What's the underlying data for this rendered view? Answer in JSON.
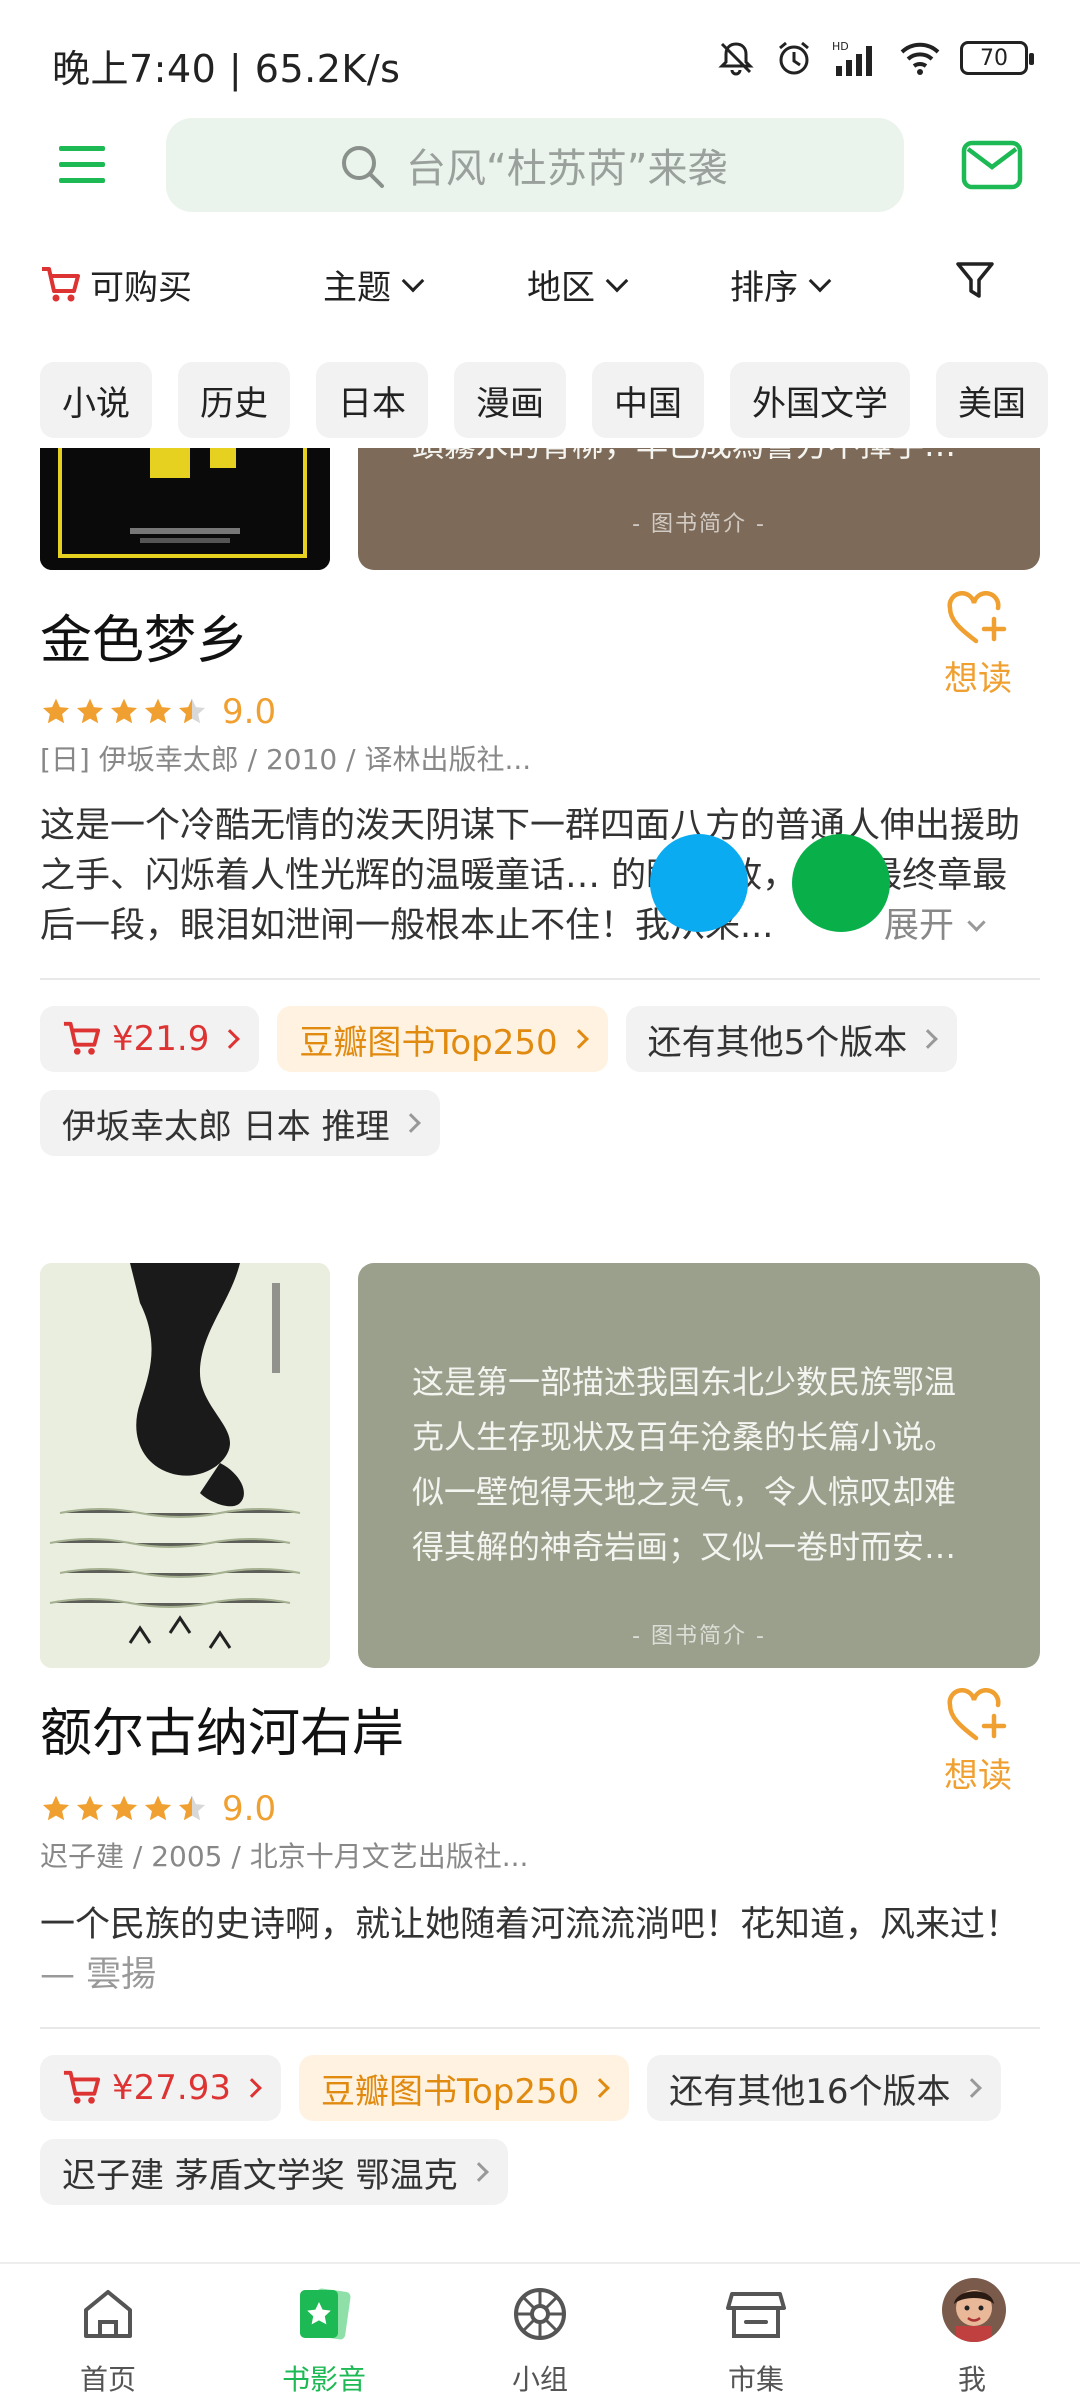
{
  "status_bar": {
    "time_speed": "晚上7:40 | 65.2K/s",
    "battery": "70",
    "icons": [
      "mute-icon",
      "alarm-icon",
      "signal-icon",
      "wifi-icon",
      "battery-icon"
    ]
  },
  "topbar": {
    "search_placeholder": "台风“杜苏芮”来袭",
    "icons": [
      "menu-icon",
      "search-icon",
      "mail-icon"
    ]
  },
  "filters": {
    "buyable": "可购买",
    "theme": "主题",
    "region": "地区",
    "sort": "排序"
  },
  "tags": [
    "小说",
    "历史",
    "日本",
    "漫画",
    "中国",
    "外国文学",
    "美国"
  ],
  "books": [
    {
      "intro_text": "頭霧水的青柳，早已成為警方不擇手…",
      "intro_label": "- 图书简介 -",
      "title": "金色梦乡",
      "rating": "9.0",
      "stars": 4.5,
      "want_label": "想读",
      "meta": "[日] 伊坂幸太郎 / 2010 / 译林出版社...",
      "review": "这是一个冷酷无情的泼天阴谋下一群四面八方的普通人伸出援助之手、闪烁着人性光辉的温暖童话…      的眼泪  收，读到最终章最后一段，眼泪如泄闸一般根本止不住！我从来...",
      "expand_label": "展开",
      "price": "¥21.9",
      "top_label": "豆瓣图书Top250",
      "versions": "还有其他5个版本",
      "tags_chip": "伊坂幸太郎 日本 推理",
      "colors": {
        "intro_bg": "#7d6a58"
      }
    },
    {
      "intro_text": "这是第一部描述我国东北少数民族鄂温克人生存现状及百年沧桑的长篇小说。似一壁饱得天地之灵气，令人惊叹却难得其解的神奇岩画；又似一卷时而安…",
      "intro_label": "- 图书简介 -",
      "title": "额尔古纳河右岸",
      "rating": "9.0",
      "stars": 4.5,
      "want_label": "想读",
      "meta": "迟子建 / 2005 / 北京十月文艺出版社...",
      "review": "一个民族的史诗啊，就让她随着河流流淌吧！花知道，风来过！",
      "review_author": "— 雲揚",
      "price": "¥27.93",
      "top_label": "豆瓣图书Top250",
      "versions": "还有其他16个版本",
      "tags_chip": "迟子建 茅盾文学奖 鄂温克",
      "colors": {
        "intro_bg": "#9aa08c"
      }
    }
  ],
  "bottom_nav": [
    {
      "label": "首页",
      "icon": "home-icon",
      "active": false
    },
    {
      "label": "书影音",
      "icon": "book-movie-icon",
      "active": true
    },
    {
      "label": "小组",
      "icon": "group-icon",
      "active": false
    },
    {
      "label": "市集",
      "icon": "market-icon",
      "active": false
    },
    {
      "label": "我",
      "icon": "avatar",
      "active": false
    }
  ],
  "colors": {
    "brand_green": "#1db954",
    "accent_orange": "#f0a030",
    "price_red": "#d33333",
    "overlay_blue": "#0aabf0",
    "overlay_green": "#09b04a"
  }
}
